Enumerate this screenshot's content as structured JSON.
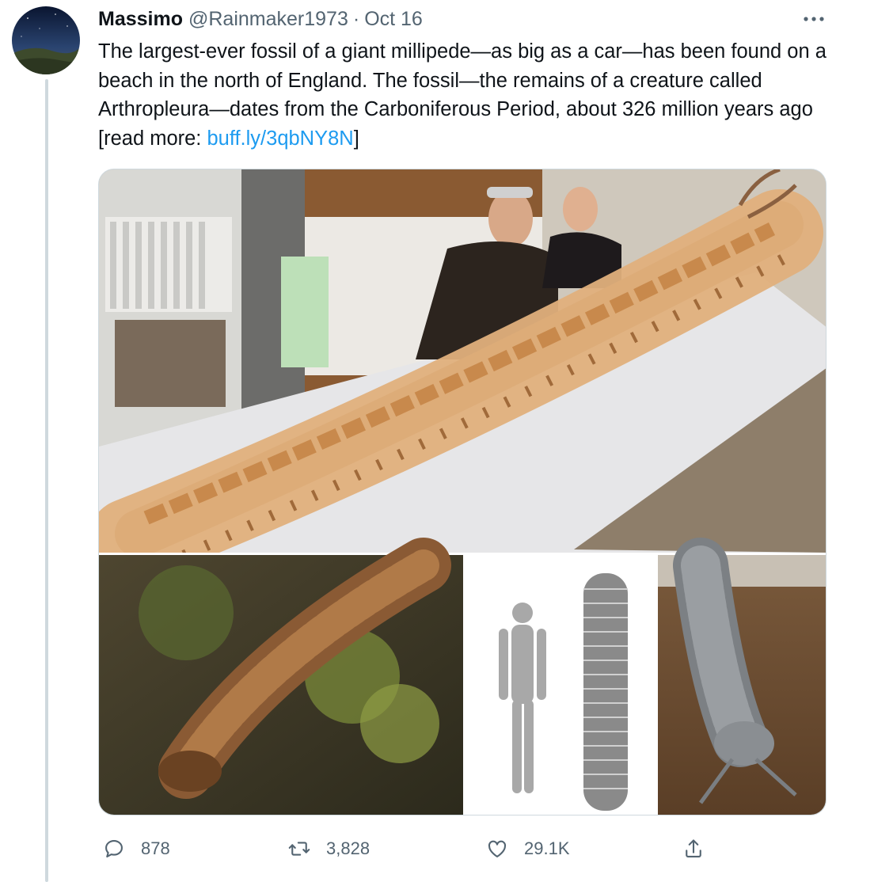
{
  "tweet": {
    "author_name": "Massimo",
    "author_handle": "@Rainmaker1973",
    "separator": "·",
    "date": "Oct 16",
    "text_before_link": "The largest-ever fossil of a giant millipede—as big as a car—has been found on a beach in the north of England. The fossil—the remains of a creature called Arthropleura—dates from the Carboniferous Period, about 326 million years ago [read more: ",
    "link_text": "buff.ly/3qbNY8N",
    "text_after_link": "]"
  },
  "icons": {
    "more": "more-horizontal-icon",
    "reply": "reply-bubble-icon",
    "retweet": "retweet-icon",
    "like": "heart-icon",
    "share": "share-upload-icon"
  },
  "actions": {
    "replies": "878",
    "retweets": "3,828",
    "likes": "29.1K"
  },
  "colors": {
    "text_primary": "#0f1419",
    "text_secondary": "#536471",
    "link": "#1d9bf0",
    "border": "#cfd9de"
  }
}
